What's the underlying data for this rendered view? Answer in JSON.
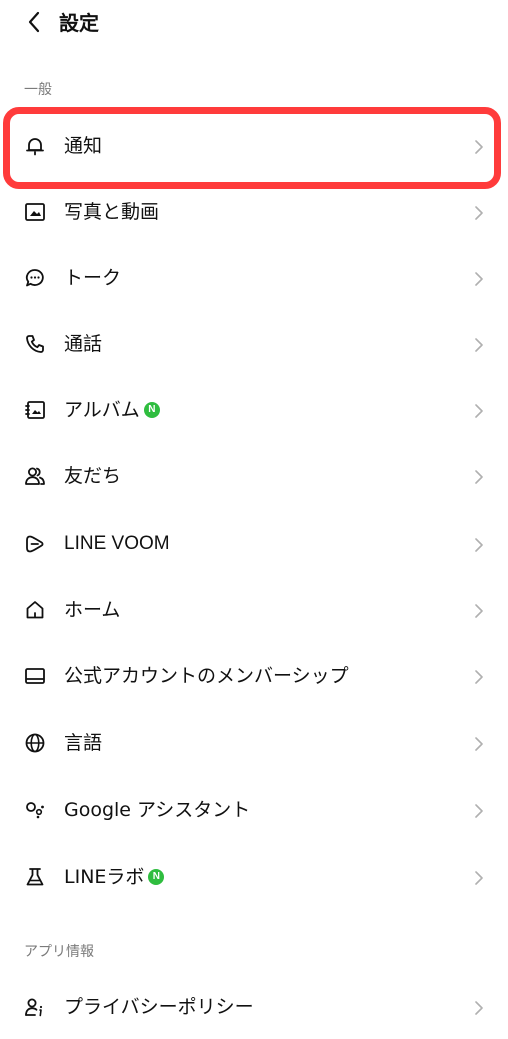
{
  "header": {
    "back_icon": "chevron-left-icon",
    "title": "設定"
  },
  "sections": {
    "general": "一般",
    "app_info": "アプリ情報"
  },
  "rows": [
    {
      "id": "notifications",
      "label": "通知",
      "icon": "bell-icon",
      "new": false
    },
    {
      "id": "photos-videos",
      "label": "写真と動画",
      "icon": "photo-icon",
      "new": false
    },
    {
      "id": "chats",
      "label": "トーク",
      "icon": "chat-bubble-icon",
      "new": false
    },
    {
      "id": "calls",
      "label": "通話",
      "icon": "phone-icon",
      "new": false
    },
    {
      "id": "albums",
      "label": "アルバム",
      "icon": "album-icon",
      "new": true
    },
    {
      "id": "friends",
      "label": "友だち",
      "icon": "friends-icon",
      "new": false
    },
    {
      "id": "line-voom",
      "label": "LINE VOOM",
      "icon": "voom-play-icon",
      "new": false
    },
    {
      "id": "home",
      "label": "ホーム",
      "icon": "home-icon",
      "new": false
    },
    {
      "id": "official-account-membership",
      "label": "公式アカウントのメンバーシップ",
      "icon": "membership-card-icon",
      "new": false
    },
    {
      "id": "language",
      "label": "言語",
      "icon": "globe-icon",
      "new": false
    },
    {
      "id": "google-assistant",
      "label": "Google アシスタント",
      "icon": "google-assistant-icon",
      "new": false
    },
    {
      "id": "line-labs",
      "label": "LINEラボ",
      "icon": "flask-icon",
      "new": true
    },
    {
      "id": "privacy-policy",
      "label": "プライバシーポリシー",
      "icon": "privacy-info-icon",
      "new": false
    }
  ],
  "new_badge_text": "N",
  "colors": {
    "highlight": "#ff3b3b",
    "new_badge": "#2fbd3f",
    "section_label": "#7b7b7b",
    "chevron": "#b0b0b0"
  }
}
